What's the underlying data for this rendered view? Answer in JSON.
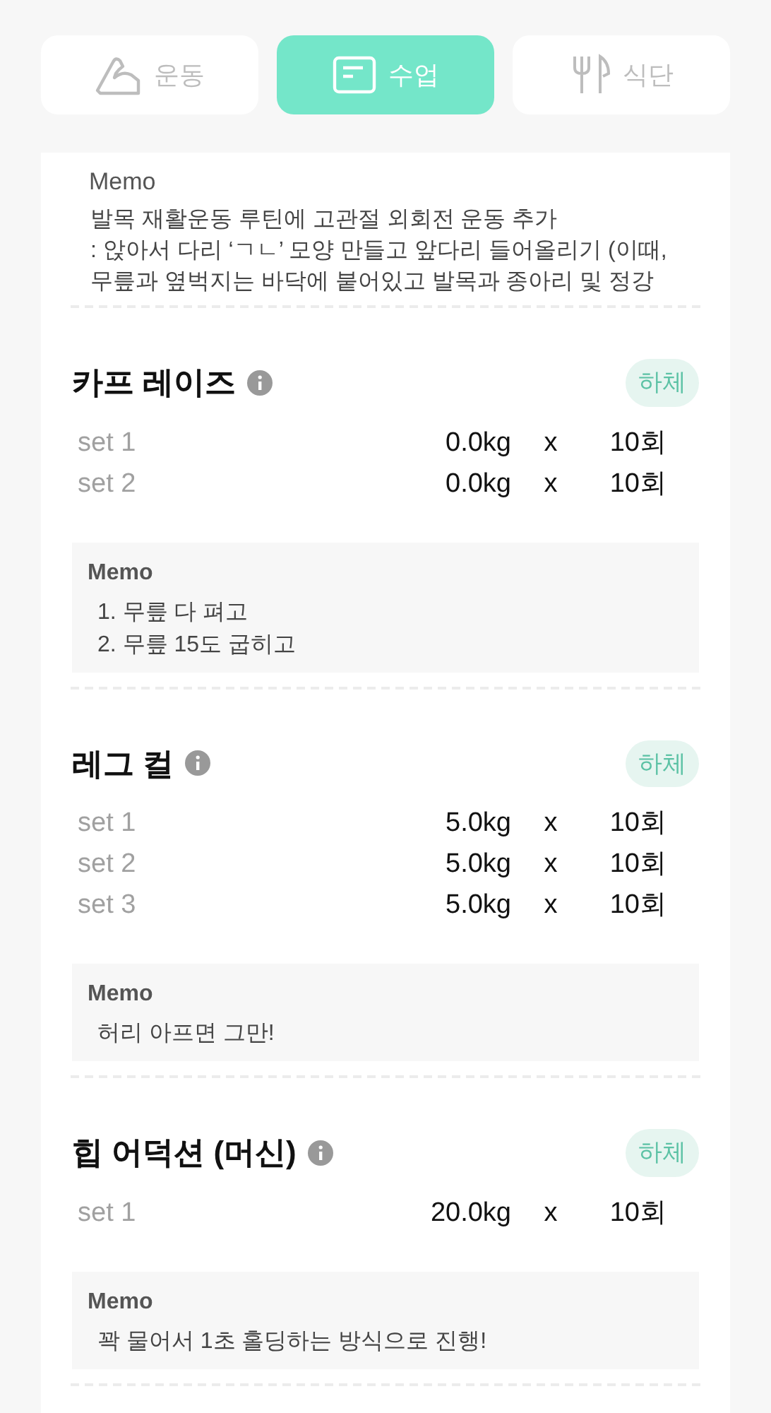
{
  "tabs": [
    {
      "kind": "exercise",
      "label": "운동",
      "selected": false
    },
    {
      "kind": "class",
      "label": "수업",
      "selected": true
    },
    {
      "kind": "diet",
      "label": "식단",
      "selected": false
    }
  ],
  "class_memo": {
    "label": "Memo",
    "lines": [
      "발목 재활운동 루틴에 고관절 외회전 운동 추가",
      ": 앉아서 다리 ‘ㄱㄴ’ 모양 만들고 앞다리 들어올리기 (이때,",
      "무릎과 옆벅지는 바닥에 붙어있고 발목과 종아리 및 정강"
    ]
  },
  "exercises": [
    {
      "name": "카프 레이즈",
      "tag": "하체",
      "sets": [
        {
          "label": "set 1",
          "weight": "0.0kg",
          "times": "x",
          "reps": "10회"
        },
        {
          "label": "set 2",
          "weight": "0.0kg",
          "times": "x",
          "reps": "10회"
        }
      ],
      "memo": {
        "label": "Memo",
        "lines": [
          "1. 무릎 다 펴고",
          "2. 무릎 15도 굽히고"
        ]
      }
    },
    {
      "name": "레그 컬",
      "tag": "하체",
      "sets": [
        {
          "label": "set 1",
          "weight": "5.0kg",
          "times": "x",
          "reps": "10회"
        },
        {
          "label": "set 2",
          "weight": "5.0kg",
          "times": "x",
          "reps": "10회"
        },
        {
          "label": "set 3",
          "weight": "5.0kg",
          "times": "x",
          "reps": "10회"
        }
      ],
      "memo": {
        "label": "Memo",
        "lines": [
          "허리 아프면 그만!"
        ]
      }
    },
    {
      "name": "힙 어덕션 (머신)",
      "tag": "하체",
      "sets": [
        {
          "label": "set 1",
          "weight": "20.0kg",
          "times": "x",
          "reps": "10회"
        }
      ],
      "memo": {
        "label": "Memo",
        "lines": [
          "꽉 물어서 1초 홀딩하는 방식으로 진행!"
        ]
      }
    }
  ]
}
